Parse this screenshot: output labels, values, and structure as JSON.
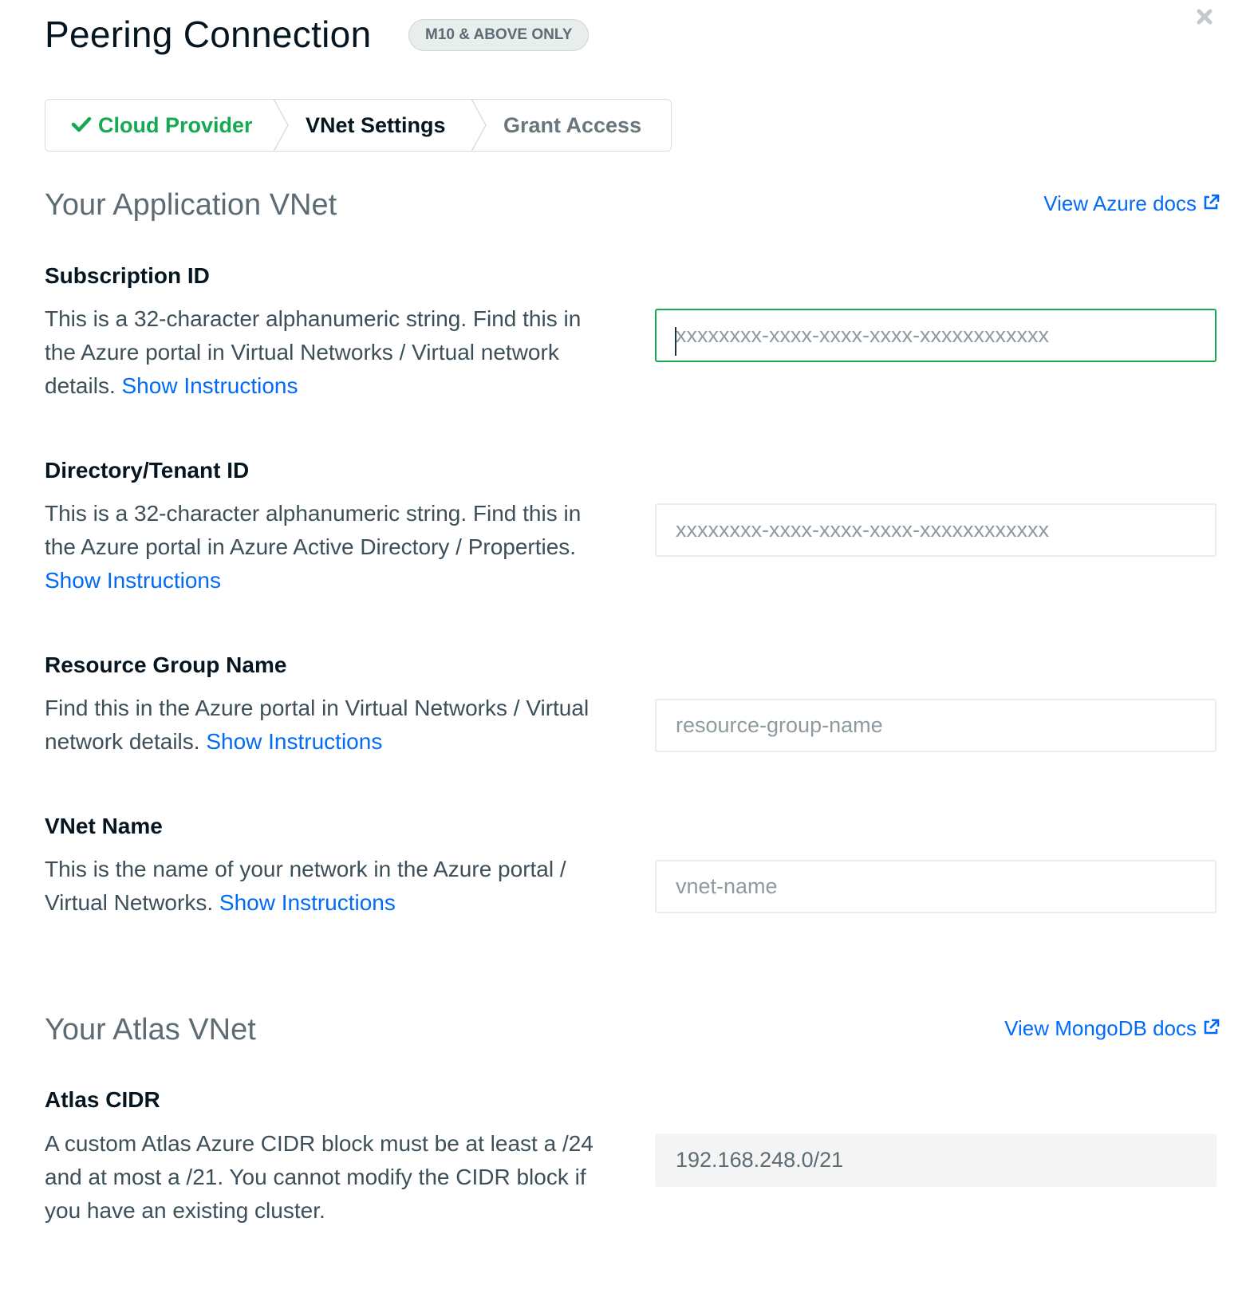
{
  "header": {
    "title": "Peering Connection",
    "badge": "M10 & ABOVE ONLY",
    "close_icon": "close-icon"
  },
  "wizard": {
    "steps": [
      {
        "label": "Cloud Provider",
        "state": "complete",
        "icon": "check-icon"
      },
      {
        "label": "VNet Settings",
        "state": "active"
      },
      {
        "label": "Grant Access",
        "state": "pending"
      }
    ]
  },
  "application_vnet": {
    "title": "Your Application VNet",
    "docs_link": "View Azure docs",
    "fields": [
      {
        "label": "Subscription ID",
        "description": "This is a 32-character alphanumeric string. Find this in the Azure portal in Virtual Networks / Virtual network details.",
        "link": "Show Instructions",
        "placeholder": "xxxxxxxx-xxxx-xxxx-xxxx-xxxxxxxxxxxx",
        "value": ""
      },
      {
        "label": "Directory/Tenant ID",
        "description": "This is a 32-character alphanumeric string. Find this in the Azure portal in Azure Active Directory / Properties.",
        "link": "Show Instructions",
        "placeholder": "xxxxxxxx-xxxx-xxxx-xxxx-xxxxxxxxxxxx",
        "value": ""
      },
      {
        "label": "Resource Group Name",
        "description": "Find this in the Azure portal in Virtual Networks / Virtual network details.",
        "link": "Show Instructions",
        "placeholder": "resource-group-name",
        "value": ""
      },
      {
        "label": "VNet Name",
        "description": "This is the name of your network in the Azure portal / Virtual Networks.",
        "link": "Show Instructions",
        "placeholder": "vnet-name",
        "value": ""
      }
    ]
  },
  "atlas_vnet": {
    "title": "Your Atlas VNet",
    "docs_link": "View MongoDB docs",
    "field": {
      "label": "Atlas CIDR",
      "description": "A custom Atlas Azure CIDR block must be at least a /24 and at most a /21. You cannot modify the CIDR block if you have an existing cluster.",
      "value": "192.168.248.0/21"
    }
  },
  "colors": {
    "accent_green": "#13aa52",
    "link_blue": "#016bf8",
    "text_dark": "#061621",
    "text_muted": "#5d6c74"
  }
}
